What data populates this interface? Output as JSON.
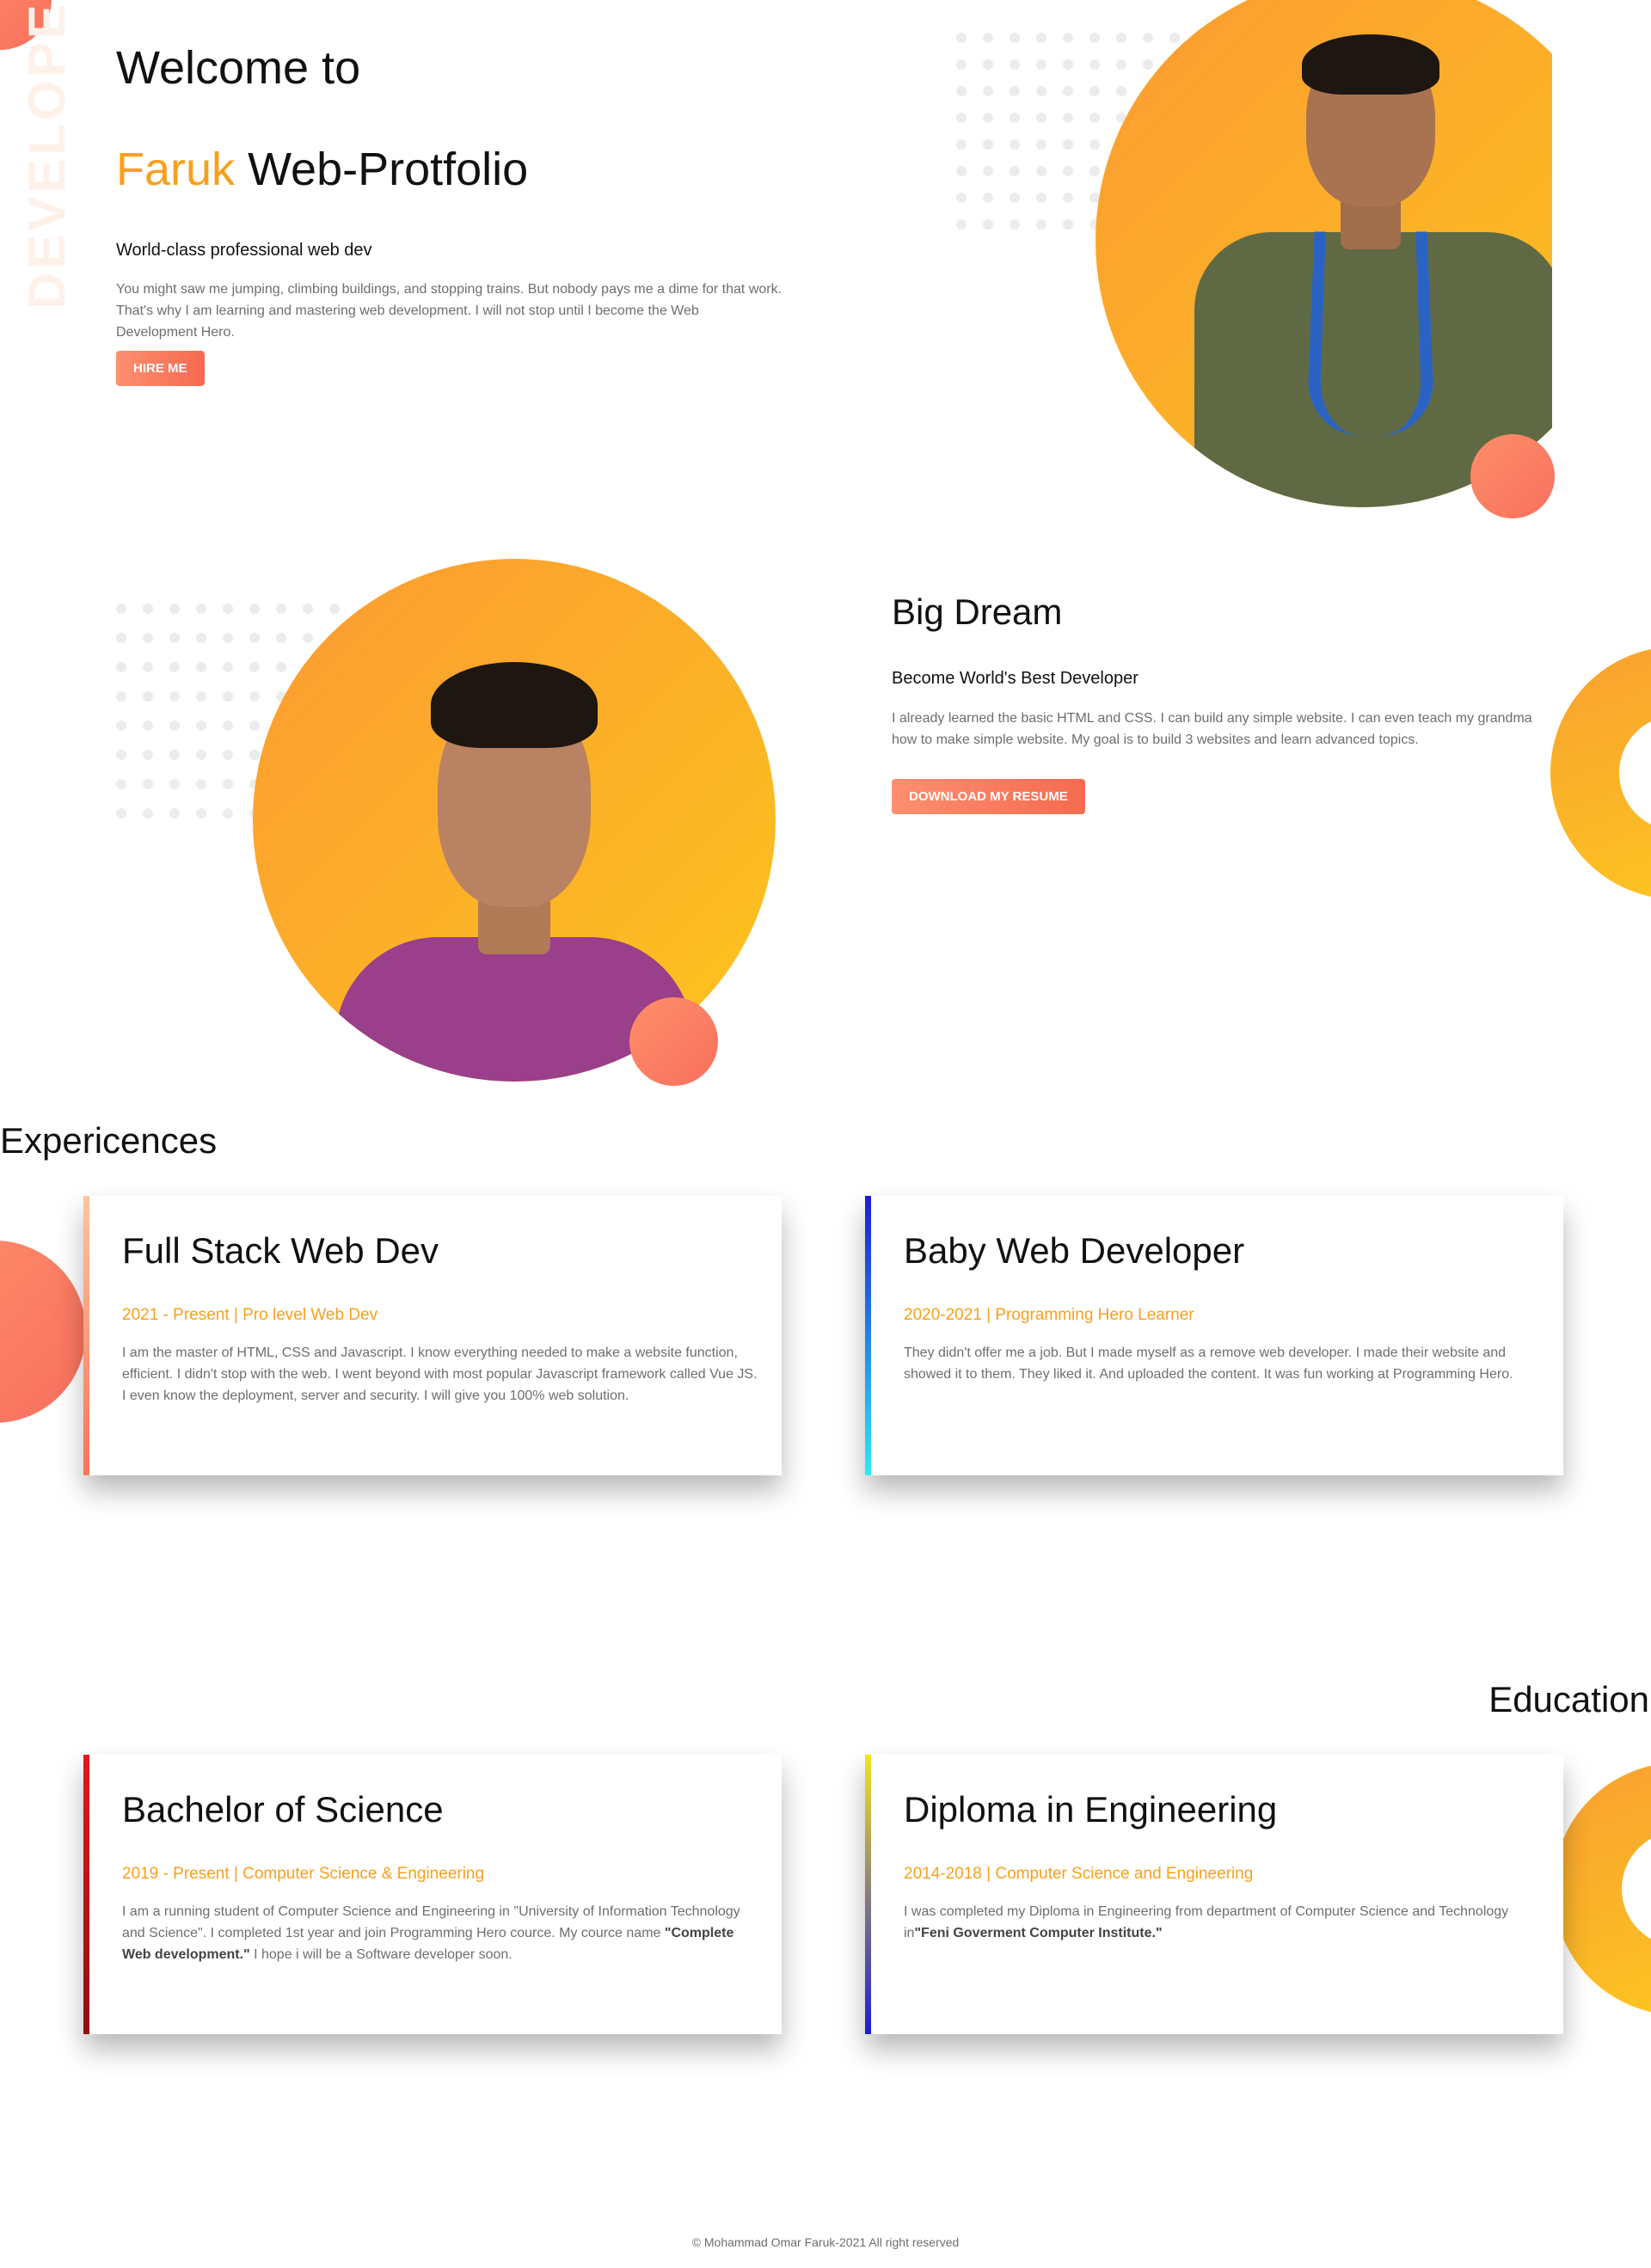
{
  "hero": {
    "vertical_text": "DEVELOPER",
    "welcome": "Welcome to",
    "name_accent": "Faruk",
    "name_rest": "Web-Protfolio",
    "tagline": "World-class professional web dev",
    "description": "You might saw me jumping, climbing buildings, and stopping trains. But nobody pays me a dime for that work. That's why I am learning and mastering web development. I will not stop until I become the Web Development Hero.",
    "button": "HIRE ME"
  },
  "dream": {
    "title": "Big Dream",
    "subtitle": "Become World's Best Developer",
    "description": "I already learned the basic HTML and CSS. I can build any simple website. I can even teach my grandma how to make simple website. My goal is to build 3 websites and learn advanced topics.",
    "button": "DOWNLOAD MY RESUME"
  },
  "experiences": {
    "heading": "Expericences",
    "cards": [
      {
        "title": "Full Stack Web Dev",
        "meta": "2021 - Present | Pro level Web Dev",
        "description": "I am the master of HTML, CSS and Javascript. I know everything needed to make a website function, efficient. I didn't stop with the web. I went beyond with most popular Javascript framework called Vue JS. I even know the deployment, server and security. I will give you 100% web solution."
      },
      {
        "title": "Baby Web Developer",
        "meta": "2020-2021 | Programming Hero Learner",
        "description": "They didn't offer me a job. But I made myself as a remove web developer. I made their website and showed it to them. They liked it. And uploaded the content. It was fun working at Programming Hero."
      }
    ]
  },
  "education": {
    "heading": "Education",
    "cards": [
      {
        "title": "Bachelor of Science",
        "meta": "2019 - Present | Computer Science & Engineering",
        "description_pre": "I am a running student of Computer Science and Engineering in \"University of Information Technology and Science\". I completed 1st year and join Programming Hero cource. My cource name ",
        "description_bold": "\"Complete Web development.\"",
        "description_post": " I hope i will be a Software developer soon."
      },
      {
        "title": "Diploma in Engineering",
        "meta": "2014-2018 | Computer Science and Engineering",
        "description_pre": "I was completed my Diploma in Engineering from department of Computer Science and Technology in",
        "description_bold": "\"Feni Goverment Computer Institute.\"",
        "description_post": ""
      }
    ]
  },
  "footer": {
    "copyright": "© Mohammad Omar Faruk-2021 All right reserved"
  },
  "colors": {
    "accent": "#f9a01b",
    "button": "#f66a50",
    "orange_blob": "#fd8e69",
    "gradient_yellow": "#fdc91f"
  }
}
